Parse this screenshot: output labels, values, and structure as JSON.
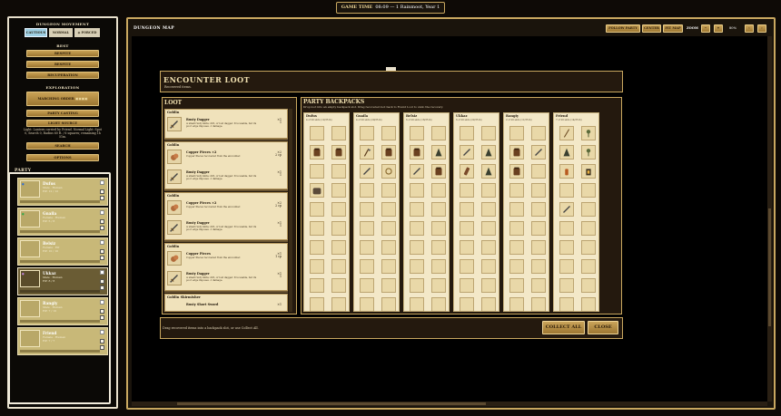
{
  "game_time": {
    "label": "GAME TIME",
    "value": "08:09 — 1 Rainmoot, Year 1"
  },
  "left": {
    "dungeon_movement": "DUNGEON MOVEMENT",
    "move_buttons": [
      "CAUTIOUS",
      "NORMAL",
      "FORCED"
    ],
    "rest_title": "REST",
    "rest_buttons": [
      "RESPITE",
      "RESPITE",
      "RECUPERATION"
    ],
    "exploration_title": "EXPLORATION",
    "marching_order": "MARCHING ORDER",
    "explore_buttons": [
      "PARTY CASTING",
      "LIGHT SOURCE"
    ],
    "light_text": "Light: Lantern carried by Friend. Normal Light: Spot 0, Search 0, Radius 60 ft. / 6 squares; remaining 1h 51m.",
    "action_buttons": [
      "SEARCH",
      "OPTIONS"
    ]
  },
  "party": {
    "title": "PARTY",
    "members": [
      {
        "name": "Dufus",
        "race": "Male · Human",
        "hp": "HP: 12 / 12"
      },
      {
        "name": "Gnaila",
        "race": "Female · Human",
        "hp": "HP: 5 / 8"
      },
      {
        "name": "Belsiz",
        "race": "Female · Elf",
        "hp": "HP: 10 / 10"
      },
      {
        "name": "Ukkaz",
        "race": "Male · Human",
        "hp": "HP: 8 / 8"
      },
      {
        "name": "Rangiy",
        "race": "Male · Human",
        "hp": "HP: 7 / 10"
      },
      {
        "name": "Friend",
        "race": "Female · Human",
        "hp": "HP: 7 / 7"
      }
    ]
  },
  "map": {
    "title": "DUNGEON MAP",
    "buttons": [
      "FOLLOW PARTY",
      "CENTER",
      "FIT MAP"
    ],
    "zoom_label": "ZOOM",
    "zoom_value": "80%"
  },
  "encounter": {
    "title": "ENCOUNTER LOOT",
    "subtitle": "Recovered items.",
    "loot_title": "LOOT",
    "groups": [
      {
        "name": "Goblin",
        "items": [
          {
            "title": "Rusty Dagger",
            "desc": "A small rusty knife; dirt, or lost dagger. It is usable, but its poor edge imposes -1 damage.",
            "qty": "×1",
            "sub": "1"
          }
        ]
      },
      {
        "name": "Goblin",
        "items": [
          {
            "title": "Copper Pieces ×2",
            "desc": "Copper Pieces recovered from the encounter.",
            "qty": "×2",
            "sub": "2 cp"
          },
          {
            "title": "Rusty Dagger",
            "desc": "A small rusty knife; dirt, or lost dagger. It is usable, but its poor edge imposes -1 damage.",
            "qty": "×1",
            "sub": "1"
          }
        ]
      },
      {
        "name": "Goblin",
        "items": [
          {
            "title": "Copper Pieces ×2",
            "desc": "Copper Pieces recovered from the encounter.",
            "qty": "×2",
            "sub": "2 cp"
          },
          {
            "title": "Rusty Dagger",
            "desc": "A small rusty knife; dirt, or lost dagger. It is usable, but its poor edge imposes -1 damage.",
            "qty": "×1",
            "sub": "1"
          }
        ]
      },
      {
        "name": "Goblin",
        "items": [
          {
            "title": "Copper Pieces",
            "desc": "Copper Pieces recovered from the encounter.",
            "qty": "×1",
            "sub": "1 cp"
          },
          {
            "title": "Rusty Dagger",
            "desc": "A small rusty knife; dirt, or lost dagger. It is usable, but its poor edge imposes -1 damage.",
            "qty": "×1",
            "sub": "1"
          }
        ]
      },
      {
        "name": "Goblin Skirmisher",
        "items": [
          {
            "title": "Rusty Short Sword",
            "desc": "",
            "qty": "×1",
            "sub": ""
          }
        ]
      }
    ],
    "backpacks_title": "PARTY BACKPACKS",
    "backpacks_sub": "Drop loot into an empty backpack slot. Drag recovered loot back to Found Loot to undo the recovery.",
    "backpacks": [
      {
        "name": "Dufus",
        "cap": "4 of 20 slots (12/35 lb)"
      },
      {
        "name": "Gnaila",
        "cap": "4 of 20 slots (20/35 lb)"
      },
      {
        "name": "Belsiz",
        "cap": "6 of 20 slots (16/35 lb)"
      },
      {
        "name": "Ukkaz",
        "cap": "6 of 20 slots (22/35 lb)"
      },
      {
        "name": "Rangiy",
        "cap": "2 of 20 slots (11/35 lb)"
      },
      {
        "name": "Friend",
        "cap": "7 of 20 slots (14/35 lb)"
      }
    ],
    "footer_hint": "Drag recovered items into a backpack slot, or use Collect All.",
    "collect_all": "COLLECT ALL",
    "close": "CLOSE"
  },
  "colors": {
    "gold": "#c9a860",
    "parchment": "#f3e8c8",
    "panel": "#24190e",
    "selected_move": "#9fd0e4"
  }
}
